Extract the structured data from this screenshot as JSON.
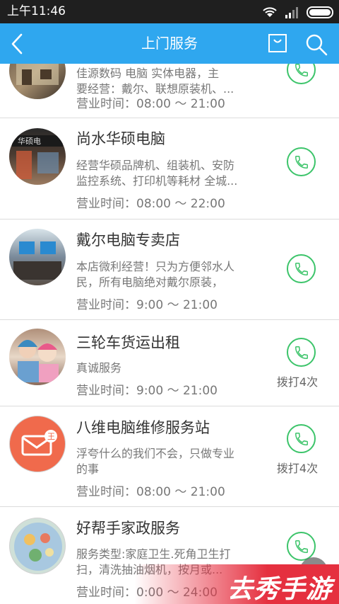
{
  "status_bar": {
    "time": "上午11:46"
  },
  "app_bar": {
    "title": "上门服务",
    "back_icon": "back-chevron-icon",
    "bag_icon": "shopping-bag-icon",
    "search_icon": "search-icon"
  },
  "colors": {
    "app_bar": "#2fa7ef",
    "call_green": "#3cc46a",
    "watermark": "#e5303f"
  },
  "shops": [
    {
      "name": "",
      "desc_lines": [
        "佳源数码 电脑 实体电器，主",
        "要经营：戴尔、联想原装机、..."
      ],
      "hours": "营业时间：08:00 ～ 21:00",
      "call_count": ""
    },
    {
      "name": "尚水华硕电脑",
      "desc_lines": [
        "经营华硕品牌机、组装机、安防",
        "监控系统、打印机等耗材 全城..."
      ],
      "hours": "营业时间：08:00 ～ 22:00",
      "call_count": ""
    },
    {
      "name": "戴尔电脑专卖店",
      "desc_lines": [
        "本店微利经营！只为方便邻水人",
        "民，所有电脑绝对戴尔原装，"
      ],
      "hours": "营业时间：9:00 ～ 21:00",
      "call_count": ""
    },
    {
      "name": "三轮车货运出租",
      "desc_lines": [
        "真诚服务"
      ],
      "hours": "营业时间：9:00 ～ 21:00",
      "call_count": "拨打4次"
    },
    {
      "name": "八维电脑维修服务站",
      "desc_lines": [
        "浮夸什么的我们不会，只做专业",
        "的事"
      ],
      "hours": "营业时间：08:00 ～ 21:00",
      "call_count": "拨打4次"
    },
    {
      "name": "好帮手家政服务",
      "desc_lines": [
        "服务类型:家庭卫生.死角卫生打",
        "扫，清洗抽油烟机，按月或..."
      ],
      "hours": "营业时间：0:00 ～ 24:00",
      "call_count": ""
    }
  ],
  "avatar_badge": "王",
  "watermark": "去秀手游"
}
